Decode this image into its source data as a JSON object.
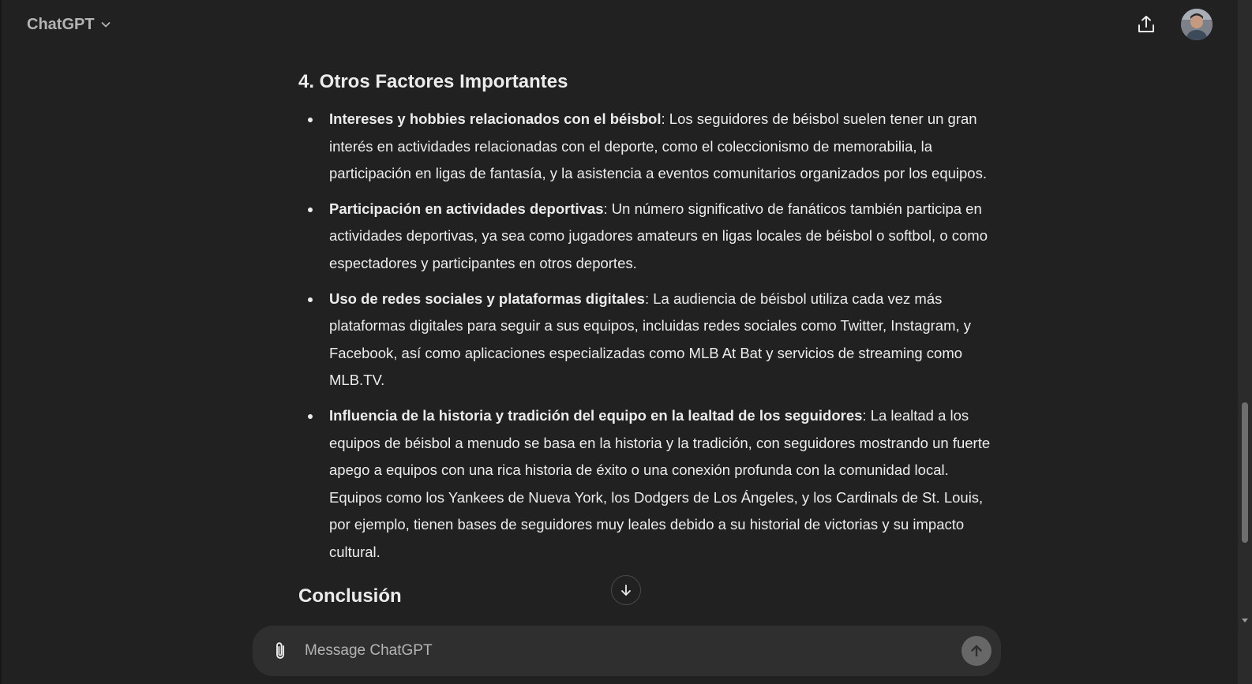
{
  "header": {
    "model_name": "ChatGPT",
    "icons": [
      "chevron-down-icon",
      "share-icon",
      "avatar"
    ]
  },
  "content": {
    "section_title": "4. Otros Factores Importantes",
    "bullets": [
      {
        "bold": "Intereses y hobbies relacionados con el béisbol",
        "text": ": Los seguidores de béisbol suelen tener un gran interés en actividades relacionadas con el deporte, como el coleccionismo de memorabilia, la participación en ligas de fantasía, y la asistencia a eventos comunitarios organizados por los equipos."
      },
      {
        "bold": "Participación en actividades deportivas",
        "text": ": Un número significativo de fanáticos también participa en actividades deportivas, ya sea como jugadores amateurs en ligas locales de béisbol o softbol, o como espectadores y participantes en otros deportes."
      },
      {
        "bold": "Uso de redes sociales y plataformas digitales",
        "text": ": La audiencia de béisbol utiliza cada vez más plataformas digitales para seguir a sus equipos, incluidas redes sociales como Twitter, Instagram, y Facebook, así como aplicaciones especializadas como MLB At Bat y servicios de streaming como MLB.TV."
      },
      {
        "bold": "Influencia de la historia y tradición del equipo en la lealtad de los seguidores",
        "text": ": La lealtad a los equipos de béisbol a menudo se basa en la historia y la tradición, con seguidores mostrando un fuerte apego a equipos con una rica historia de éxito o una conexión profunda con la comunidad local. Equipos como los Yankees de Nueva York, los Dodgers de Los Ángeles, y los Cardinals de St. Louis, por ejemplo, tienen bases de seguidores muy leales debido a su historial de victorias y su impacto cultural."
      }
    ],
    "next_section_title": "Conclusión"
  },
  "composer": {
    "placeholder": "Message ChatGPT",
    "value": "",
    "icons": [
      "paperclip-icon",
      "arrow-up-icon"
    ]
  },
  "scroll_down_icon": "arrow-down-icon"
}
